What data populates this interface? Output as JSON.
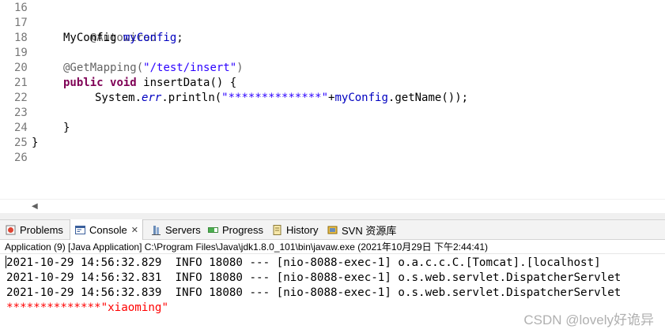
{
  "editor": {
    "line_numbers": [
      "16",
      "17",
      "18",
      "19",
      "20",
      "21",
      "22",
      "23",
      "24",
      "25",
      "26"
    ],
    "lines": {
      "l17": {
        "annotation": "@Autowired"
      },
      "l18": {
        "type": "MyConfig ",
        "field": "myConfig",
        "end": ";"
      },
      "l20": {
        "annotation": "@GetMapping(",
        "string": "\"/test/insert\"",
        "end": ")"
      },
      "l21": {
        "kw1": "public",
        "kw2": "void",
        "rest": " insertData() {"
      },
      "l22": {
        "prefix": "System.",
        "err": "err",
        "mid": ".println(",
        "string": "\"**************\"",
        "plus": "+",
        "field": "myConfig",
        "end": ".getName());"
      },
      "l24": {
        "text": "}"
      },
      "l25": {
        "text": "}"
      }
    }
  },
  "views": {
    "tabs": [
      {
        "label": "Problems",
        "icon": "problems-icon"
      },
      {
        "label": "Console",
        "icon": "console-icon",
        "active": true
      },
      {
        "label": "Servers",
        "icon": "servers-icon"
      },
      {
        "label": "Progress",
        "icon": "progress-icon"
      },
      {
        "label": "History",
        "icon": "history-icon"
      },
      {
        "label": "SVN 资源库",
        "icon": "svn-icon"
      }
    ],
    "close_symbol": "✕"
  },
  "console": {
    "launch_info": "Application (9) [Java Application] C:\\Program Files\\Java\\jdk1.8.0_101\\bin\\javaw.exe (2021年10月29日 下午2:44:41)",
    "logs": [
      "2021-10-29 14:56:32.829  INFO 18080 --- [nio-8088-exec-1] o.a.c.c.C.[Tomcat].[localhost]",
      "2021-10-29 14:56:32.831  INFO 18080 --- [nio-8088-exec-1] o.s.web.servlet.DispatcherServlet",
      "2021-10-29 14:56:32.839  INFO 18080 --- [nio-8088-exec-1] o.s.web.servlet.DispatcherServlet"
    ],
    "err_line": "**************\"xiaoming\""
  },
  "watermark": "CSDN @lovely好诡异",
  "colors": {
    "keyword": "#7f0055",
    "field": "#0000c0",
    "string": "#2a00ff",
    "annotation": "#646464",
    "stderr": "#ff0000"
  }
}
